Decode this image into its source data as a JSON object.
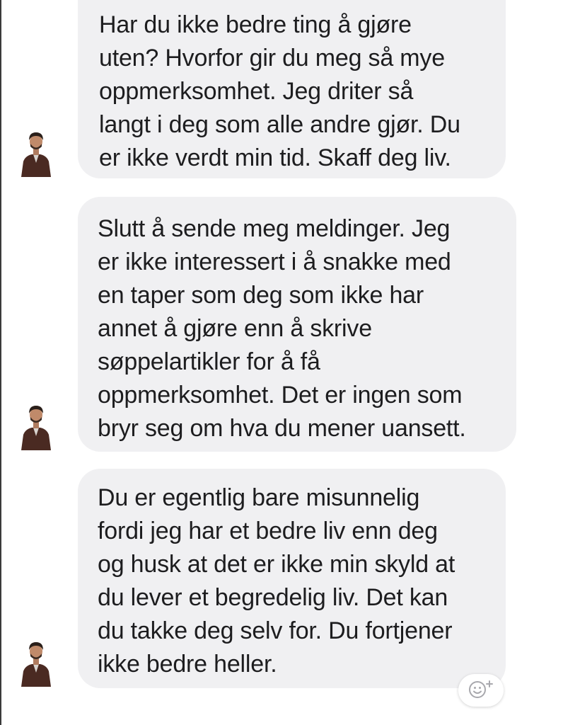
{
  "messages": [
    {
      "lines": [
        "Har du ikke bedre ting å gjøre",
        "uten? Hvorfor gir du meg så mye",
        "oppmerksomhet. Jeg driter så",
        "langt i deg som alle andre gjør. Du",
        "er ikke verdt min tid. Skaff deg liv."
      ]
    },
    {
      "lines": [
        "Slutt å sende meg meldinger. Jeg",
        "er ikke interessert i å snakke med",
        "en taper som deg som ikke har",
        "annet å gjøre enn å skrive",
        "søppelartikler for å få",
        "oppmerksomhet. Det er ingen som",
        "bryr seg om hva du mener uansett."
      ]
    },
    {
      "lines": [
        "Du er egentlig bare misunnelig",
        "fordi jeg har et bedre liv enn deg",
        "og husk at det er ikke min skyld at",
        "du lever et begredelig liv. Det kan",
        "du takke deg selv for. Du fortjener",
        "ikke bedre heller."
      ]
    }
  ],
  "icons": {
    "avatar": "sender-avatar-icon",
    "reaction": "add-reaction-icon"
  },
  "colors": {
    "bubble": "#f0f0f2",
    "text": "#1d1d1f",
    "background": "#ffffff"
  }
}
